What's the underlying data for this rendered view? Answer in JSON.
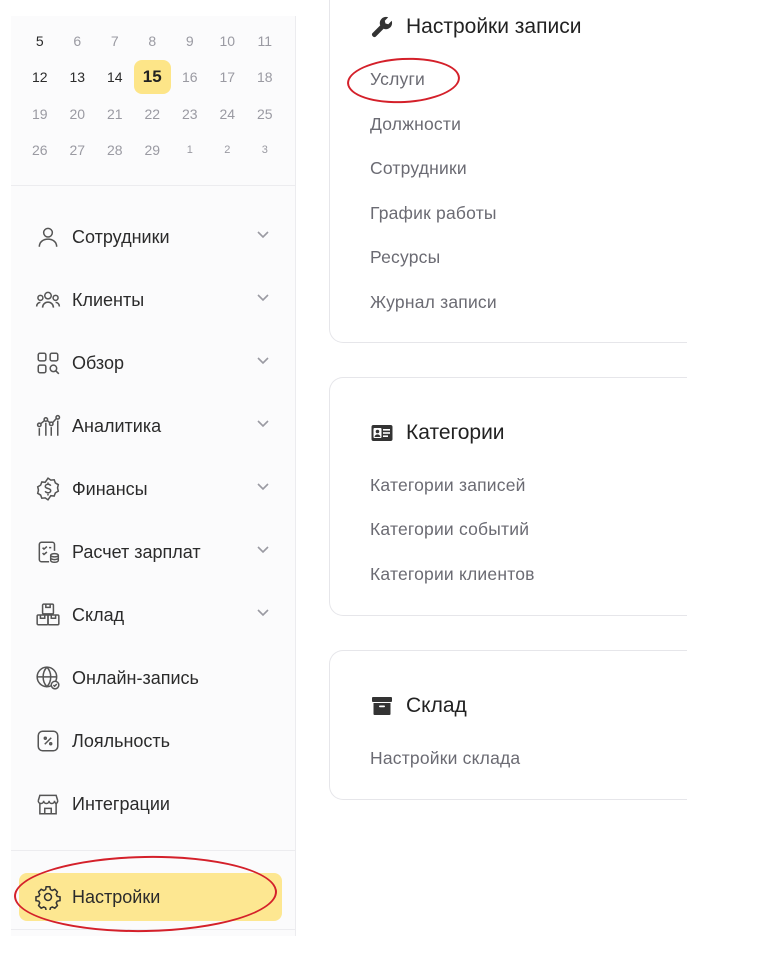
{
  "calendar": {
    "rows": [
      [
        {
          "d": "5"
        },
        {
          "d": "6",
          "muted": true
        },
        {
          "d": "7",
          "muted": true
        },
        {
          "d": "8",
          "muted": true
        },
        {
          "d": "9",
          "muted": true
        },
        {
          "d": "10",
          "muted": true
        },
        {
          "d": "11",
          "muted": true
        }
      ],
      [
        {
          "d": "12"
        },
        {
          "d": "13"
        },
        {
          "d": "14"
        },
        {
          "d": "15",
          "today": true
        },
        {
          "d": "16",
          "muted": true
        },
        {
          "d": "17",
          "muted": true
        },
        {
          "d": "18",
          "muted": true
        }
      ],
      [
        {
          "d": "19",
          "muted": true
        },
        {
          "d": "20",
          "muted": true
        },
        {
          "d": "21",
          "muted": true
        },
        {
          "d": "22",
          "muted": true
        },
        {
          "d": "23",
          "muted": true
        },
        {
          "d": "24",
          "muted": true
        },
        {
          "d": "25",
          "muted": true
        }
      ],
      [
        {
          "d": "26",
          "muted": true
        },
        {
          "d": "27",
          "muted": true
        },
        {
          "d": "28",
          "muted": true
        },
        {
          "d": "29",
          "muted": true
        },
        {
          "d": "1",
          "tiny": true
        },
        {
          "d": "2",
          "tiny": true
        },
        {
          "d": "3",
          "tiny": true
        }
      ]
    ]
  },
  "sidebar": {
    "items": [
      {
        "label": "Сотрудники",
        "icon": "user-icon",
        "chevron": true
      },
      {
        "label": "Клиенты",
        "icon": "users-icon",
        "chevron": true
      },
      {
        "label": "Обзор",
        "icon": "grid-search-icon",
        "chevron": true
      },
      {
        "label": "Аналитика",
        "icon": "analytics-icon",
        "chevron": true
      },
      {
        "label": "Финансы",
        "icon": "dollar-badge-icon",
        "chevron": true
      },
      {
        "label": "Расчет зарплат",
        "icon": "payroll-icon",
        "chevron": true
      },
      {
        "label": "Склад",
        "icon": "boxes-icon",
        "chevron": true
      },
      {
        "label": "Онлайн-запись",
        "icon": "globe-icon",
        "chevron": false
      },
      {
        "label": "Лояльность",
        "icon": "discount-icon",
        "chevron": false
      },
      {
        "label": "Интеграции",
        "icon": "store-icon",
        "chevron": false
      }
    ],
    "settings_label": "Настройки"
  },
  "main": {
    "booking": {
      "title": "Настройки записи",
      "links": [
        "Услуги",
        "Должности",
        "Сотрудники",
        "График работы",
        "Ресурсы",
        "Журнал записи"
      ]
    },
    "categories": {
      "title": "Категории",
      "links": [
        "Категории записей",
        "Категории событий",
        "Категории клиентов"
      ]
    },
    "warehouse": {
      "title": "Склад",
      "links": [
        "Настройки склада"
      ]
    }
  },
  "colors": {
    "accent": "#fde588",
    "annotation": "#d4202a"
  }
}
